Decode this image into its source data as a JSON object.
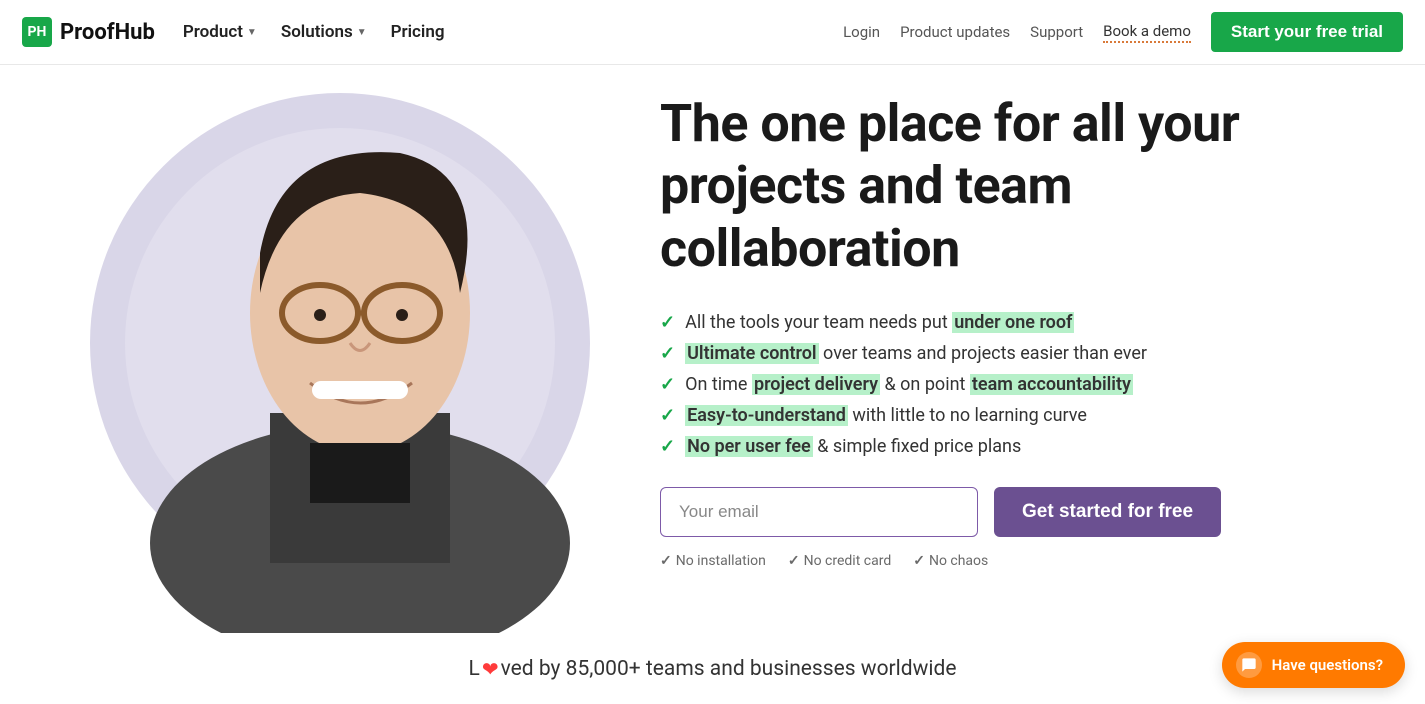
{
  "brand": {
    "badge": "PH",
    "name": "ProofHub"
  },
  "nav": {
    "product": "Product",
    "solutions": "Solutions",
    "pricing": "Pricing"
  },
  "header_right": {
    "login": "Login",
    "updates": "Product updates",
    "support": "Support",
    "demo": "Book a demo",
    "trial": "Start your free trial"
  },
  "hero": {
    "title": "The one place for all your projects and team collaboration"
  },
  "features": [
    {
      "pre": "All the tools your team needs put ",
      "hl": "under one roof",
      "post": ""
    },
    {
      "pre": "",
      "hl": "Ultimate control",
      "post": " over teams and projects easier than ever"
    },
    {
      "pre": "On time ",
      "hl": "project delivery",
      "mid": " & on point ",
      "hl2": "team accountability",
      "post": ""
    },
    {
      "pre": "",
      "hl": "Easy-to-understand",
      "post": " with little to no learning curve"
    },
    {
      "pre": "",
      "hl": "No per user fee",
      "post": " & simple fixed price plans"
    }
  ],
  "signup": {
    "placeholder": "Your email",
    "button": "Get started for free"
  },
  "subnotes": {
    "a": "No installation",
    "b": "No credit card",
    "c": "No chaos"
  },
  "love": {
    "pre": "L",
    "post": "ved by 85,000+ teams and businesses worldwide"
  },
  "help": {
    "label": "Have questions?"
  }
}
